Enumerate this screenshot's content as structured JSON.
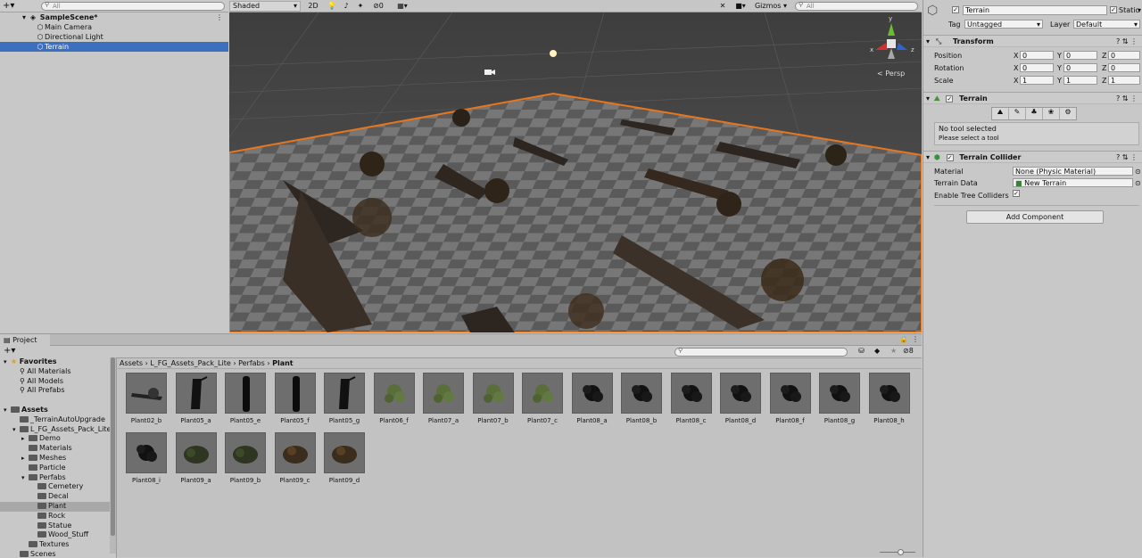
{
  "hierarchy": {
    "search_placeholder": "All",
    "scene_name": "SampleScene*",
    "items": [
      "Main Camera",
      "Directional Light",
      "Terrain"
    ]
  },
  "scene_toolbar": {
    "shading": "Shaded",
    "mode_2d": "2D",
    "hidden_count": "0",
    "gizmos": "Gizmos",
    "search_placeholder": "All",
    "persp": "< Persp",
    "axis_x": "x",
    "axis_y": "y",
    "axis_z": "z"
  },
  "inspector": {
    "object_name": "Terrain",
    "static_label": "Static",
    "tag_label": "Tag",
    "tag_value": "Untagged",
    "layer_label": "Layer",
    "layer_value": "Default",
    "transform": {
      "title": "Transform",
      "rows": [
        {
          "label": "Position",
          "x": "0",
          "y": "0",
          "z": "0"
        },
        {
          "label": "Rotation",
          "x": "0",
          "y": "0",
          "z": "0"
        },
        {
          "label": "Scale",
          "x": "1",
          "y": "1",
          "z": "1"
        }
      ],
      "axis_labels": [
        "X",
        "Y",
        "Z"
      ]
    },
    "terrain": {
      "title": "Terrain",
      "no_tool": "No tool selected",
      "hint": "Please select a tool"
    },
    "collider": {
      "title": "Terrain Collider",
      "material_label": "Material",
      "material_value": "None (Physic Material)",
      "data_label": "Terrain Data",
      "data_value": "New Terrain",
      "tree_label": "Enable Tree Colliders"
    },
    "add_component": "Add Component"
  },
  "project": {
    "tab": "Project",
    "badge_count": "8",
    "breadcrumb": [
      "Assets",
      "L_FG_Assets_Pack_Lite",
      "Perfabs",
      "Plant"
    ],
    "tree": [
      {
        "label": "Favorites",
        "level": 0,
        "kind": "star",
        "bold": true
      },
      {
        "label": "All Materials",
        "level": 1,
        "kind": "search"
      },
      {
        "label": "All Models",
        "level": 1,
        "kind": "search"
      },
      {
        "label": "All Prefabs",
        "level": 1,
        "kind": "search"
      },
      {
        "label": "",
        "level": 0,
        "kind": "blank"
      },
      {
        "label": "Assets",
        "level": 0,
        "kind": "folder",
        "bold": true
      },
      {
        "label": "_TerrainAutoUpgrade",
        "level": 1,
        "kind": "folder"
      },
      {
        "label": "L_FG_Assets_Pack_Lite",
        "level": 1,
        "kind": "folder"
      },
      {
        "label": "Demo",
        "level": 2,
        "kind": "folder"
      },
      {
        "label": "Materials",
        "level": 2,
        "kind": "folder"
      },
      {
        "label": "Meshes",
        "level": 2,
        "kind": "folder"
      },
      {
        "label": "Particle",
        "level": 2,
        "kind": "folder"
      },
      {
        "label": "Perfabs",
        "level": 2,
        "kind": "folder"
      },
      {
        "label": "Cemetery",
        "level": 3,
        "kind": "folder"
      },
      {
        "label": "Decal",
        "level": 3,
        "kind": "folder"
      },
      {
        "label": "Plant",
        "level": 3,
        "kind": "folder",
        "selected": true
      },
      {
        "label": "Rock",
        "level": 3,
        "kind": "folder"
      },
      {
        "label": "Statue",
        "level": 3,
        "kind": "folder"
      },
      {
        "label": "Wood_Stuff",
        "level": 3,
        "kind": "folder"
      },
      {
        "label": "Textures",
        "level": 2,
        "kind": "folder"
      },
      {
        "label": "Scenes",
        "level": 1,
        "kind": "folder"
      }
    ],
    "assets": [
      {
        "name": "Plant02_b",
        "style": "branch"
      },
      {
        "name": "Plant05_a",
        "style": "trunk"
      },
      {
        "name": "Plant05_e",
        "style": "log"
      },
      {
        "name": "Plant05_f",
        "style": "log"
      },
      {
        "name": "Plant05_g",
        "style": "trunk"
      },
      {
        "name": "Plant06_f",
        "style": "green"
      },
      {
        "name": "Plant07_a",
        "style": "green"
      },
      {
        "name": "Plant07_b",
        "style": "green"
      },
      {
        "name": "Plant07_c",
        "style": "green"
      },
      {
        "name": "Plant08_a",
        "style": "dark"
      },
      {
        "name": "Plant08_b",
        "style": "dark"
      },
      {
        "name": "Plant08_c",
        "style": "dark"
      },
      {
        "name": "Plant08_d",
        "style": "dark"
      },
      {
        "name": "Plant08_f",
        "style": "dark"
      },
      {
        "name": "Plant08_g",
        "style": "dark"
      },
      {
        "name": "Plant08_h",
        "style": "dark"
      },
      {
        "name": "Plant08_i",
        "style": "dark"
      },
      {
        "name": "Plant09_a",
        "style": "bush"
      },
      {
        "name": "Plant09_b",
        "style": "bush"
      },
      {
        "name": "Plant09_c",
        "style": "bushbrown"
      },
      {
        "name": "Plant09_d",
        "style": "bushbrown"
      }
    ]
  }
}
